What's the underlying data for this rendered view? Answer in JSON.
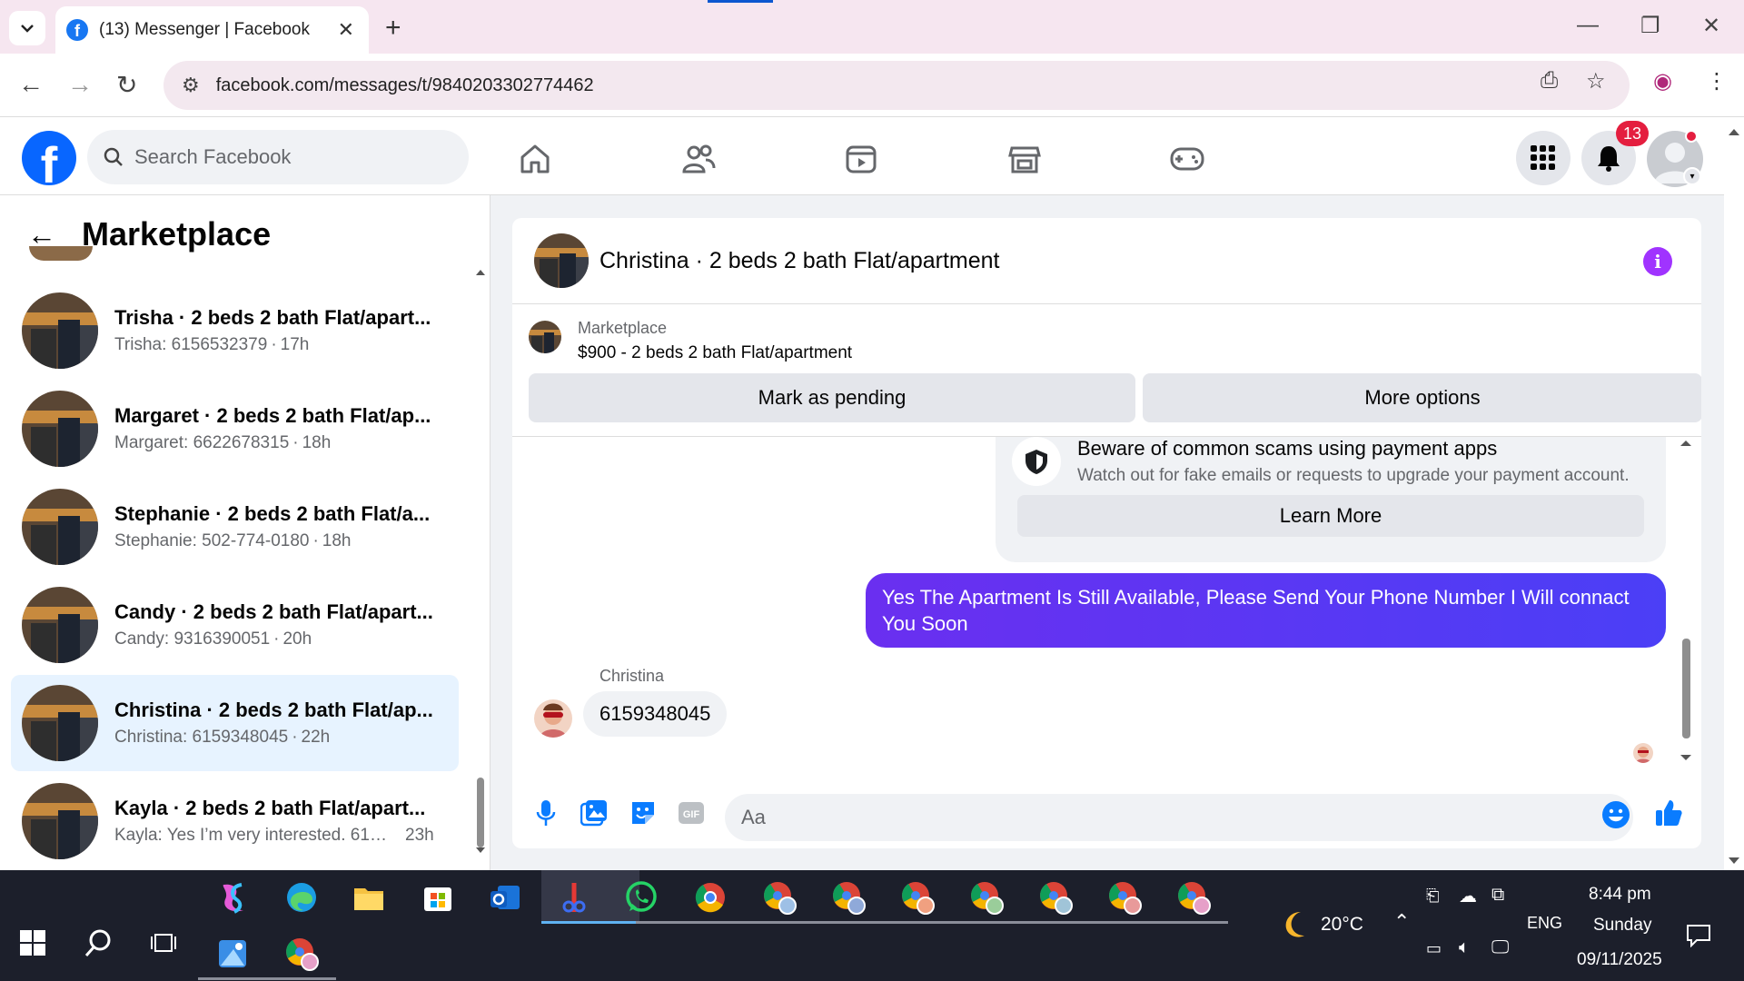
{
  "browser": {
    "tab_title": "(13) Messenger | Facebook",
    "url": "facebook.com/messages/t/9840203302774462"
  },
  "fb": {
    "search_placeholder": "Search Facebook",
    "notification_count": "13",
    "logo": "f"
  },
  "left": {
    "title": "Marketplace",
    "conversations": [
      {
        "name": "Trisha · 2 beds 2 bath Flat/apart...",
        "snippet": "Trisha: 6156532379",
        "time": "17h"
      },
      {
        "name": "Margaret · 2 beds 2 bath Flat/ap...",
        "snippet": "Margaret: 6622678315",
        "time": "18h"
      },
      {
        "name": "Stephanie · 2 beds 2 bath Flat/a...",
        "snippet": "Stephanie: 502-774-0180",
        "time": "18h"
      },
      {
        "name": "Candy · 2 beds 2 bath Flat/apart...",
        "snippet": "Candy: 9316390051",
        "time": "20h"
      },
      {
        "name": "Christina · 2 beds 2 bath Flat/ap...",
        "snippet": "Christina: 6159348045",
        "time": "22h"
      },
      {
        "name": "Kayla · 2 beds 2 bath Flat/apart...",
        "snippet": "Kayla: Yes I’m very interested. 615...",
        "time": "23h"
      }
    ]
  },
  "chat": {
    "title": "Christina · 2 beds 2 bath Flat/apartment",
    "listing_label": "Marketplace",
    "listing_price": "$900 - 2 beds 2 bath Flat/apartment",
    "btn_pending": "Mark as pending",
    "btn_more": "More options",
    "scam_title": "Beware of common scams using payment apps",
    "scam_text": "Watch out for fake emails or requests to upgrade your payment account.",
    "scam_btn": "Learn More",
    "outgoing": "Yes The Apartment Is Still Available, Please Send Your Phone Number I Will connact You Soon",
    "sender": "Christina",
    "incoming": "6159348045",
    "composer_placeholder": "Aa"
  },
  "taskbar": {
    "weather": "20°C",
    "lang": "ENG",
    "time": "8:44 pm",
    "day": "Sunday",
    "date": "09/11/2025"
  }
}
